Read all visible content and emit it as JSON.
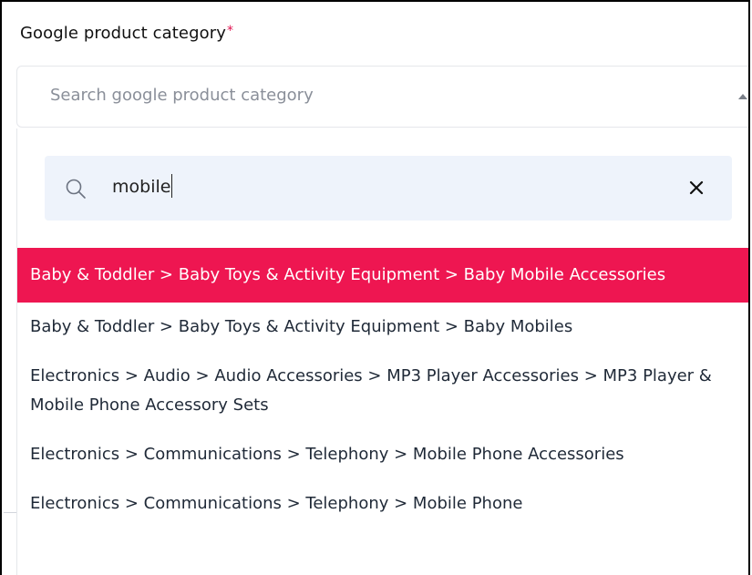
{
  "field": {
    "label": "Google product category",
    "required_marker": "*",
    "placeholder": "Search google product category"
  },
  "search": {
    "value": "mobile",
    "clear_symbol": "✕"
  },
  "options": [
    {
      "label": "Baby & Toddler > Baby Toys & Activity Equipment > Baby Mobile Accessories",
      "selected": true
    },
    {
      "label": "Baby & Toddler > Baby Toys & Activity Equipment > Baby Mobiles",
      "selected": false
    },
    {
      "label": "Electronics > Audio > Audio Accessories > MP3 Player Accessories > MP3 Player & Mobile Phone Accessory Sets",
      "selected": false
    },
    {
      "label": "Electronics > Communications > Telephony > Mobile Phone Accessories",
      "selected": false
    },
    {
      "label": "Electronics > Communications > Telephony > Mobile Phone",
      "selected": false
    }
  ],
  "colors": {
    "accent": "#ee1651",
    "required": "#e0114f",
    "search_bg": "#eef3fb"
  },
  "icons": {
    "search": "search-icon",
    "clear": "close-icon",
    "caret": "caret-up-icon"
  }
}
